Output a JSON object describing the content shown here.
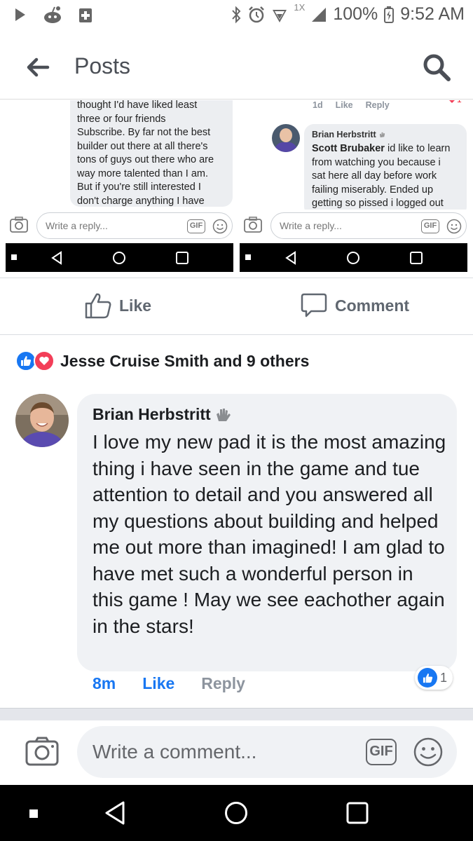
{
  "status_bar": {
    "battery": "100%",
    "time": "9:52 AM",
    "speed_label": "1X"
  },
  "app_bar": {
    "title": "Posts"
  },
  "screenshot_left": {
    "text": "thought I'd have liked least\nthree or four  friends\nSubscribe. By far not the best\nbuilder out there at all there's\ntons of guys out there who are\nway more talented than I am.\nBut if you're still interested I\ndon't charge anything I have",
    "reply_placeholder": "Write a reply...",
    "gif_label": "GIF"
  },
  "screenshot_right": {
    "time": "1d",
    "like": "Like",
    "reply": "Reply",
    "badge_count": "1",
    "author": "Brian Herbstritt",
    "mention": "Scott Brubaker",
    "text": " id like to learn\nfrom watching you because i\nsat here all day before work\nfailing miserably. Ended up\ngetting so pissed i logged out",
    "reply_placeholder": "Write a reply...",
    "gif_label": "GIF"
  },
  "actions": {
    "like": "Like",
    "comment": "Comment"
  },
  "reactions": {
    "summary": "Jesse Cruise Smith and 9 others"
  },
  "comment": {
    "author": "Brian Herbstritt",
    "body": "I love my new pad it is the most amazing thing i have seen in the game and tue attention to detail and you answered all my questions about building and helped me out more than imagined! I am glad to have met such a wonderful person in this game ! May we see eachother again in the stars!",
    "time": "8m",
    "like": "Like",
    "reply": "Reply",
    "like_count": "1"
  },
  "composer": {
    "placeholder": "Write a comment...",
    "gif_label": "GIF"
  },
  "colors": {
    "facebook_blue": "#1877f2",
    "love_red": "#f33e58",
    "bubble_gray": "#f0f2f5"
  }
}
